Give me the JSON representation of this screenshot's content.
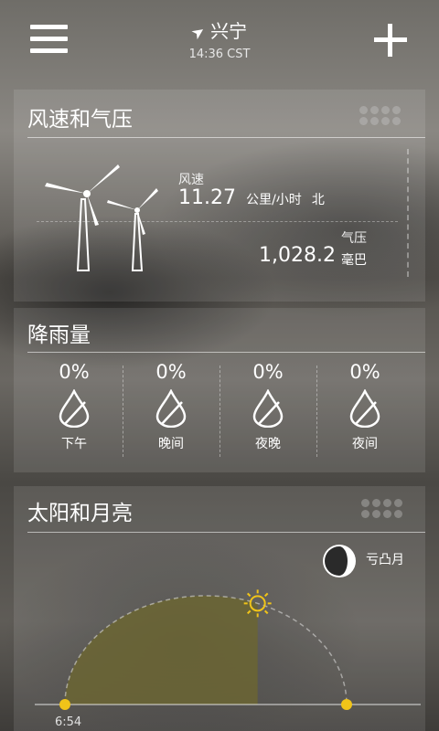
{
  "header": {
    "location": "兴宁",
    "time": "14:36 CST"
  },
  "wind_card": {
    "title": "风速和气压",
    "wind_label": "风速",
    "wind_value": "11.27",
    "wind_unit": "公里/小时",
    "wind_dir": "北",
    "pressure_label": "气压",
    "pressure_value": "1,028.2",
    "pressure_unit": "毫巴"
  },
  "rain_card": {
    "title": "降雨量",
    "periods": [
      {
        "pct": "0%",
        "label": "下午"
      },
      {
        "pct": "0%",
        "label": "晚间"
      },
      {
        "pct": "0%",
        "label": "夜晚"
      },
      {
        "pct": "0%",
        "label": "夜间"
      }
    ]
  },
  "sun_card": {
    "title": "太阳和月亮",
    "moon_phase": "亏凸月",
    "sunrise": "6:54",
    "day_progress": 0.62
  },
  "colors": {
    "sun_fill": "#6b6532",
    "sun_icon": "#f0c419"
  },
  "icons": [
    "menu-icon",
    "location-arrow-icon",
    "add-icon",
    "wind-turbine-icon",
    "raindrop-icon",
    "moon-icon",
    "sun-icon"
  ]
}
